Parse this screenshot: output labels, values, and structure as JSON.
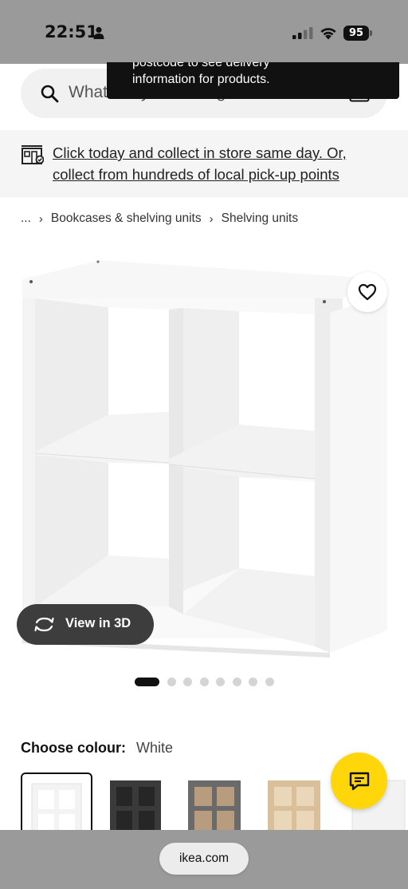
{
  "status_bar": {
    "time": "22:51",
    "battery": "95",
    "icons": [
      "person-icon",
      "signal-icon",
      "wifi-icon",
      "battery-icon"
    ]
  },
  "search": {
    "placeholder": "What are you looking for?",
    "icons": [
      "search-icon",
      "scan-icon"
    ]
  },
  "tooltip": {
    "line1": "postcode to see delivery",
    "line2": "information for products."
  },
  "banner": {
    "text": "Click today and collect in store same day. Or, collect from hundreds of local pick-up points",
    "icon": "store-icon"
  },
  "breadcrumb": {
    "items": [
      "...",
      "Bookcases & shelving units",
      "Shelving units"
    ]
  },
  "product": {
    "view3d_label": "View in 3D",
    "image_count": 8,
    "active_image": 1
  },
  "colour": {
    "label": "Choose colour:",
    "value": "White",
    "swatches": [
      "White",
      "Black-brown",
      "Dark grey",
      "White stained oak effect",
      "White"
    ]
  },
  "browser": {
    "url": "ikea.com"
  },
  "colors": {
    "chat_accent": "#ffd60a",
    "status_bar_bg": "#9a9a9a",
    "view3d_bg": "#3d3d3d"
  }
}
